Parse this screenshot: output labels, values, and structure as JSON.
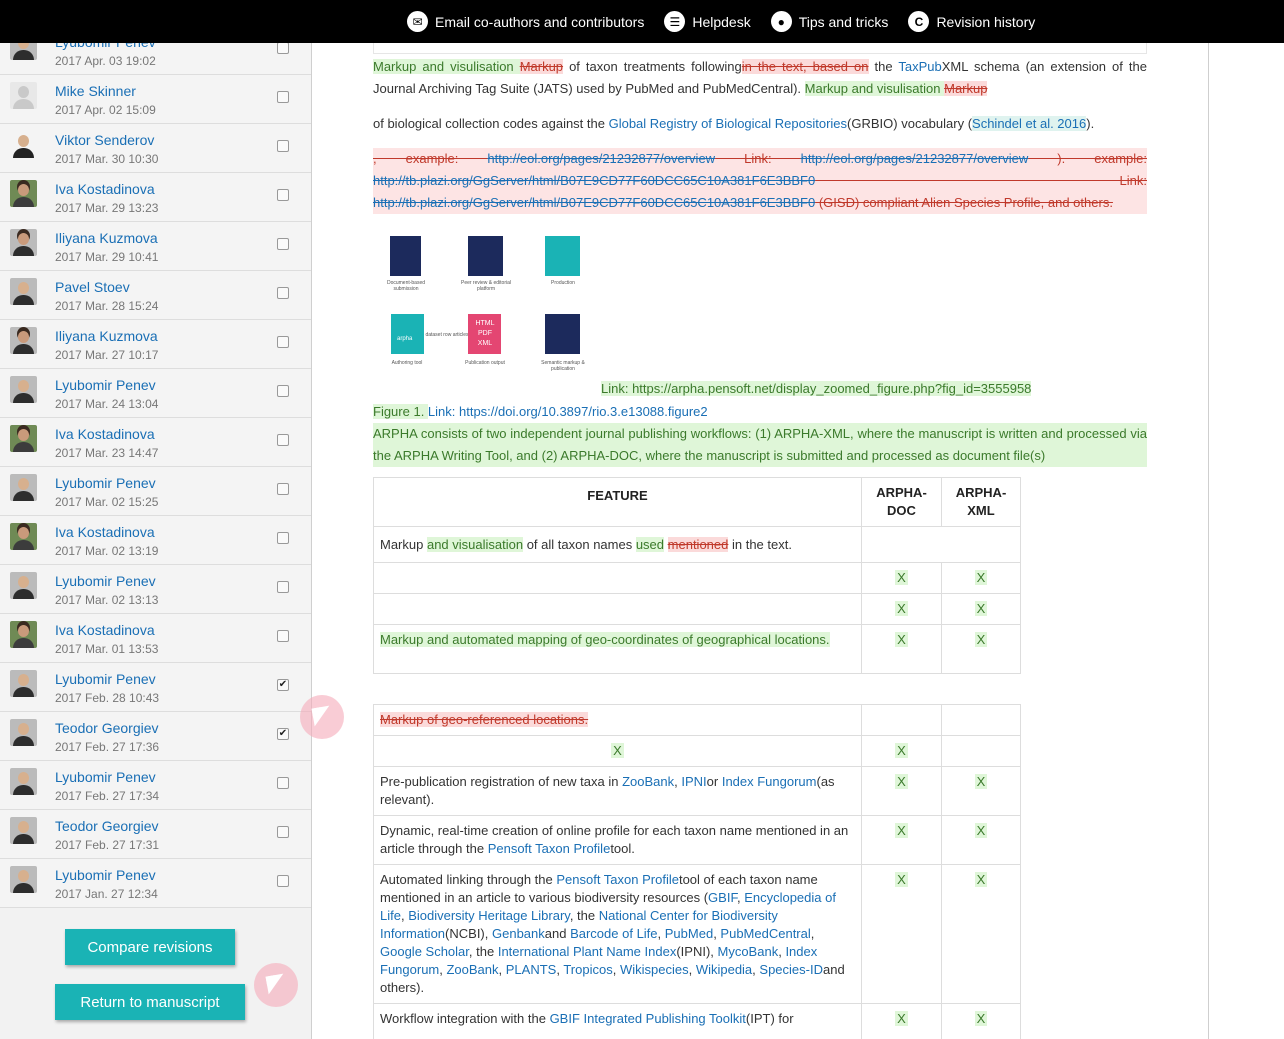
{
  "topbar": {
    "items": [
      {
        "label": "Email co-authors and contributors",
        "icon": "envelope-icon"
      },
      {
        "label": "Helpdesk",
        "icon": "helpdesk-icon"
      },
      {
        "label": "Tips and tricks",
        "icon": "lightbulb-icon"
      },
      {
        "label": "Revision history",
        "icon": "history-icon"
      }
    ]
  },
  "revisions": [
    {
      "name": "Lyubomir Penev",
      "date": "2017 Apr. 03 19:02",
      "checked": false
    },
    {
      "name": "Mike Skinner",
      "date": "2017 Apr. 02 15:09",
      "checked": false
    },
    {
      "name": "Viktor Senderov",
      "date": "2017 Mar. 30 10:30",
      "checked": false
    },
    {
      "name": "Iva Kostadinova",
      "date": "2017 Mar. 29 13:23",
      "checked": false
    },
    {
      "name": "Iliyana Kuzmova",
      "date": "2017 Mar. 29 10:41",
      "checked": false
    },
    {
      "name": "Pavel Stoev",
      "date": "2017 Mar. 28 15:24",
      "checked": false
    },
    {
      "name": "Iliyana Kuzmova",
      "date": "2017 Mar. 27 10:17",
      "checked": false
    },
    {
      "name": "Lyubomir Penev",
      "date": "2017 Mar. 24 13:04",
      "checked": false
    },
    {
      "name": "Iva Kostadinova",
      "date": "2017 Mar. 23 14:47",
      "checked": false
    },
    {
      "name": "Lyubomir Penev",
      "date": "2017 Mar. 02 15:25",
      "checked": false
    },
    {
      "name": "Iva Kostadinova",
      "date": "2017 Mar. 02 13:19",
      "checked": false
    },
    {
      "name": "Lyubomir Penev",
      "date": "2017 Mar. 02 13:13",
      "checked": false
    },
    {
      "name": "Iva Kostadinova",
      "date": "2017 Mar. 01 13:53",
      "checked": false
    },
    {
      "name": "Lyubomir Penev",
      "date": "2017 Feb. 28 10:43",
      "checked": true
    },
    {
      "name": "Teodor Georgiev",
      "date": "2017 Feb. 27 17:36",
      "checked": true
    },
    {
      "name": "Lyubomir Penev",
      "date": "2017 Feb. 27 17:34",
      "checked": false
    },
    {
      "name": "Teodor Georgiev",
      "date": "2017 Feb. 27 17:31",
      "checked": false
    },
    {
      "name": "Lyubomir Penev",
      "date": "2017 Jan. 27 12:34",
      "checked": false
    }
  ],
  "buttons": {
    "compare": "Compare revisions",
    "return": "Return to manuscript"
  },
  "doc": {
    "p1": {
      "ins1": "Markup and visulisation ",
      "del1": "Markup",
      "t1": " of taxon treatments following",
      "del2": "in the text, based on",
      "t2": " the ",
      "link1": "TaxPub",
      "t3": "XML schema (an extension of the Journal Archiving Tag Suite (JATS) used by PubMed and PubMedCentral). ",
      "ins2": "Markup and visulisation ",
      "del3": "Markup"
    },
    "p2": {
      "t1": "of biological collection codes against the ",
      "link1": "Global Registry of Biological Repositories",
      "t2": "(GRBIO) vocabulary (",
      "ref": "Schindel et al. 2016",
      "t3": ")."
    },
    "p3": {
      "t1": ", example: ",
      "link1": "http://eol.org/pages/21232877/overview",
      "t2": " Link: ",
      "link2": "http://eol.org/pages/21232877/overview",
      "t3": " ). example: ",
      "link3": "http://tb.plazi.org/GgServer/html/B07E9CD77F60DCC65C10A381F6E3BBF0",
      "t4": " Link: ",
      "link4": "http://tb.plazi.org/GgServer/html/B07E9CD77F60DCC65C10A381F6E3BBF0",
      "t5": " (GISD) compliant Alien Species Profile, and others."
    },
    "figure": {
      "nodes": [
        {
          "label": "Document-based submission"
        },
        {
          "label": "Peer review & editorial platform"
        },
        {
          "label": "Production"
        },
        {
          "label": "Authoring tool"
        },
        {
          "label": "Publication output"
        },
        {
          "label": "Semantic markup & publication"
        }
      ],
      "arpha_label": "arpha",
      "out_label": "HTML PDF XML",
      "arrow_label": "dataset row articles",
      "link_prefix": "Link: ",
      "link_url": "https://arpha.pensoft.net/display_zoomed_figure.php?fig_id=3555958",
      "caption_prefix": "Figure 1. ",
      "caption_link_prefix": "Link: ",
      "caption_url": "https://doi.org/10.3897/rio.3.e13088.figure2"
    },
    "p4": "ARPHA consists of two independent journal publishing workflows: (1) ARPHA-XML, where the manuscript is written and processed via the ARPHA Writing Tool, and (2) ARPHA-DOC, where the manuscript is submitted and processed as document file(s)",
    "table": {
      "headers": [
        "FEATURE",
        "ARPHA-DOC",
        "ARPHA-XML"
      ],
      "x": "X",
      "r1": {
        "t1": "Markup ",
        "ins1": "and visualisation",
        "t2": " of all taxon names ",
        "ins2": "used",
        "t3": " ",
        "del1": "mentioned",
        "t4": " in the text."
      },
      "r4": "Markup and automated mapping of geo-coordinates of geographical locations.",
      "r5": "Markup of geo-referenced locations.",
      "r7": {
        "t1": "Pre-publication registration of new taxa in ",
        "l1": "ZooBank",
        "t2": ", ",
        "l2": "IPNI",
        "t3": "or ",
        "l3": "Index Fungorum",
        "t4": "(as relevant)."
      },
      "r8": {
        "t1": "Dynamic, real-time creation of online profile for each taxon name mentioned in an article through the ",
        "l1": "Pensoft Taxon Profile",
        "t2": "tool."
      },
      "r9": {
        "t1": "Automated linking through the ",
        "l1": "Pensoft Taxon Profile",
        "t2": "tool of each taxon name mentioned in an article to various biodiversity resources (",
        "l2": "GBIF",
        "t3": ", ",
        "l3": "Encyclopedia of Life",
        "t4": ", ",
        "l4": "Biodiversity Heritage Library",
        "t5": ", the ",
        "l5": "National Center for Biodiversity Information",
        "t6": "(NCBI), ",
        "l6": "Genbank",
        "t7": "and ",
        "l7": "Barcode of Life",
        "t8": ", ",
        "l8": "PubMed",
        "t9": ", ",
        "l9": "PubMedCentral",
        "t10": ", ",
        "l10": "Google Scholar",
        "t11": ", the ",
        "l11": "International Plant Name Index",
        "t12": "(IPNI), ",
        "l12": "MycoBank",
        "t13": ", ",
        "l13": "Index Fungorum",
        "t14": ", ",
        "l14": "ZooBank",
        "t15": ", ",
        "l15": "PLANTS",
        "t16": ", ",
        "l16": "Tropicos",
        "t17": ", ",
        "l17": "Wikispecies",
        "t18": ", ",
        "l18": "Wikipedia",
        "t19": ", ",
        "l19": "Species-ID",
        "t20": "and others)."
      },
      "r10": {
        "t1": "Workflow integration with the ",
        "l1": "GBIF Integrated Publishing Toolkit",
        "t2": "(IPT) for"
      }
    }
  }
}
